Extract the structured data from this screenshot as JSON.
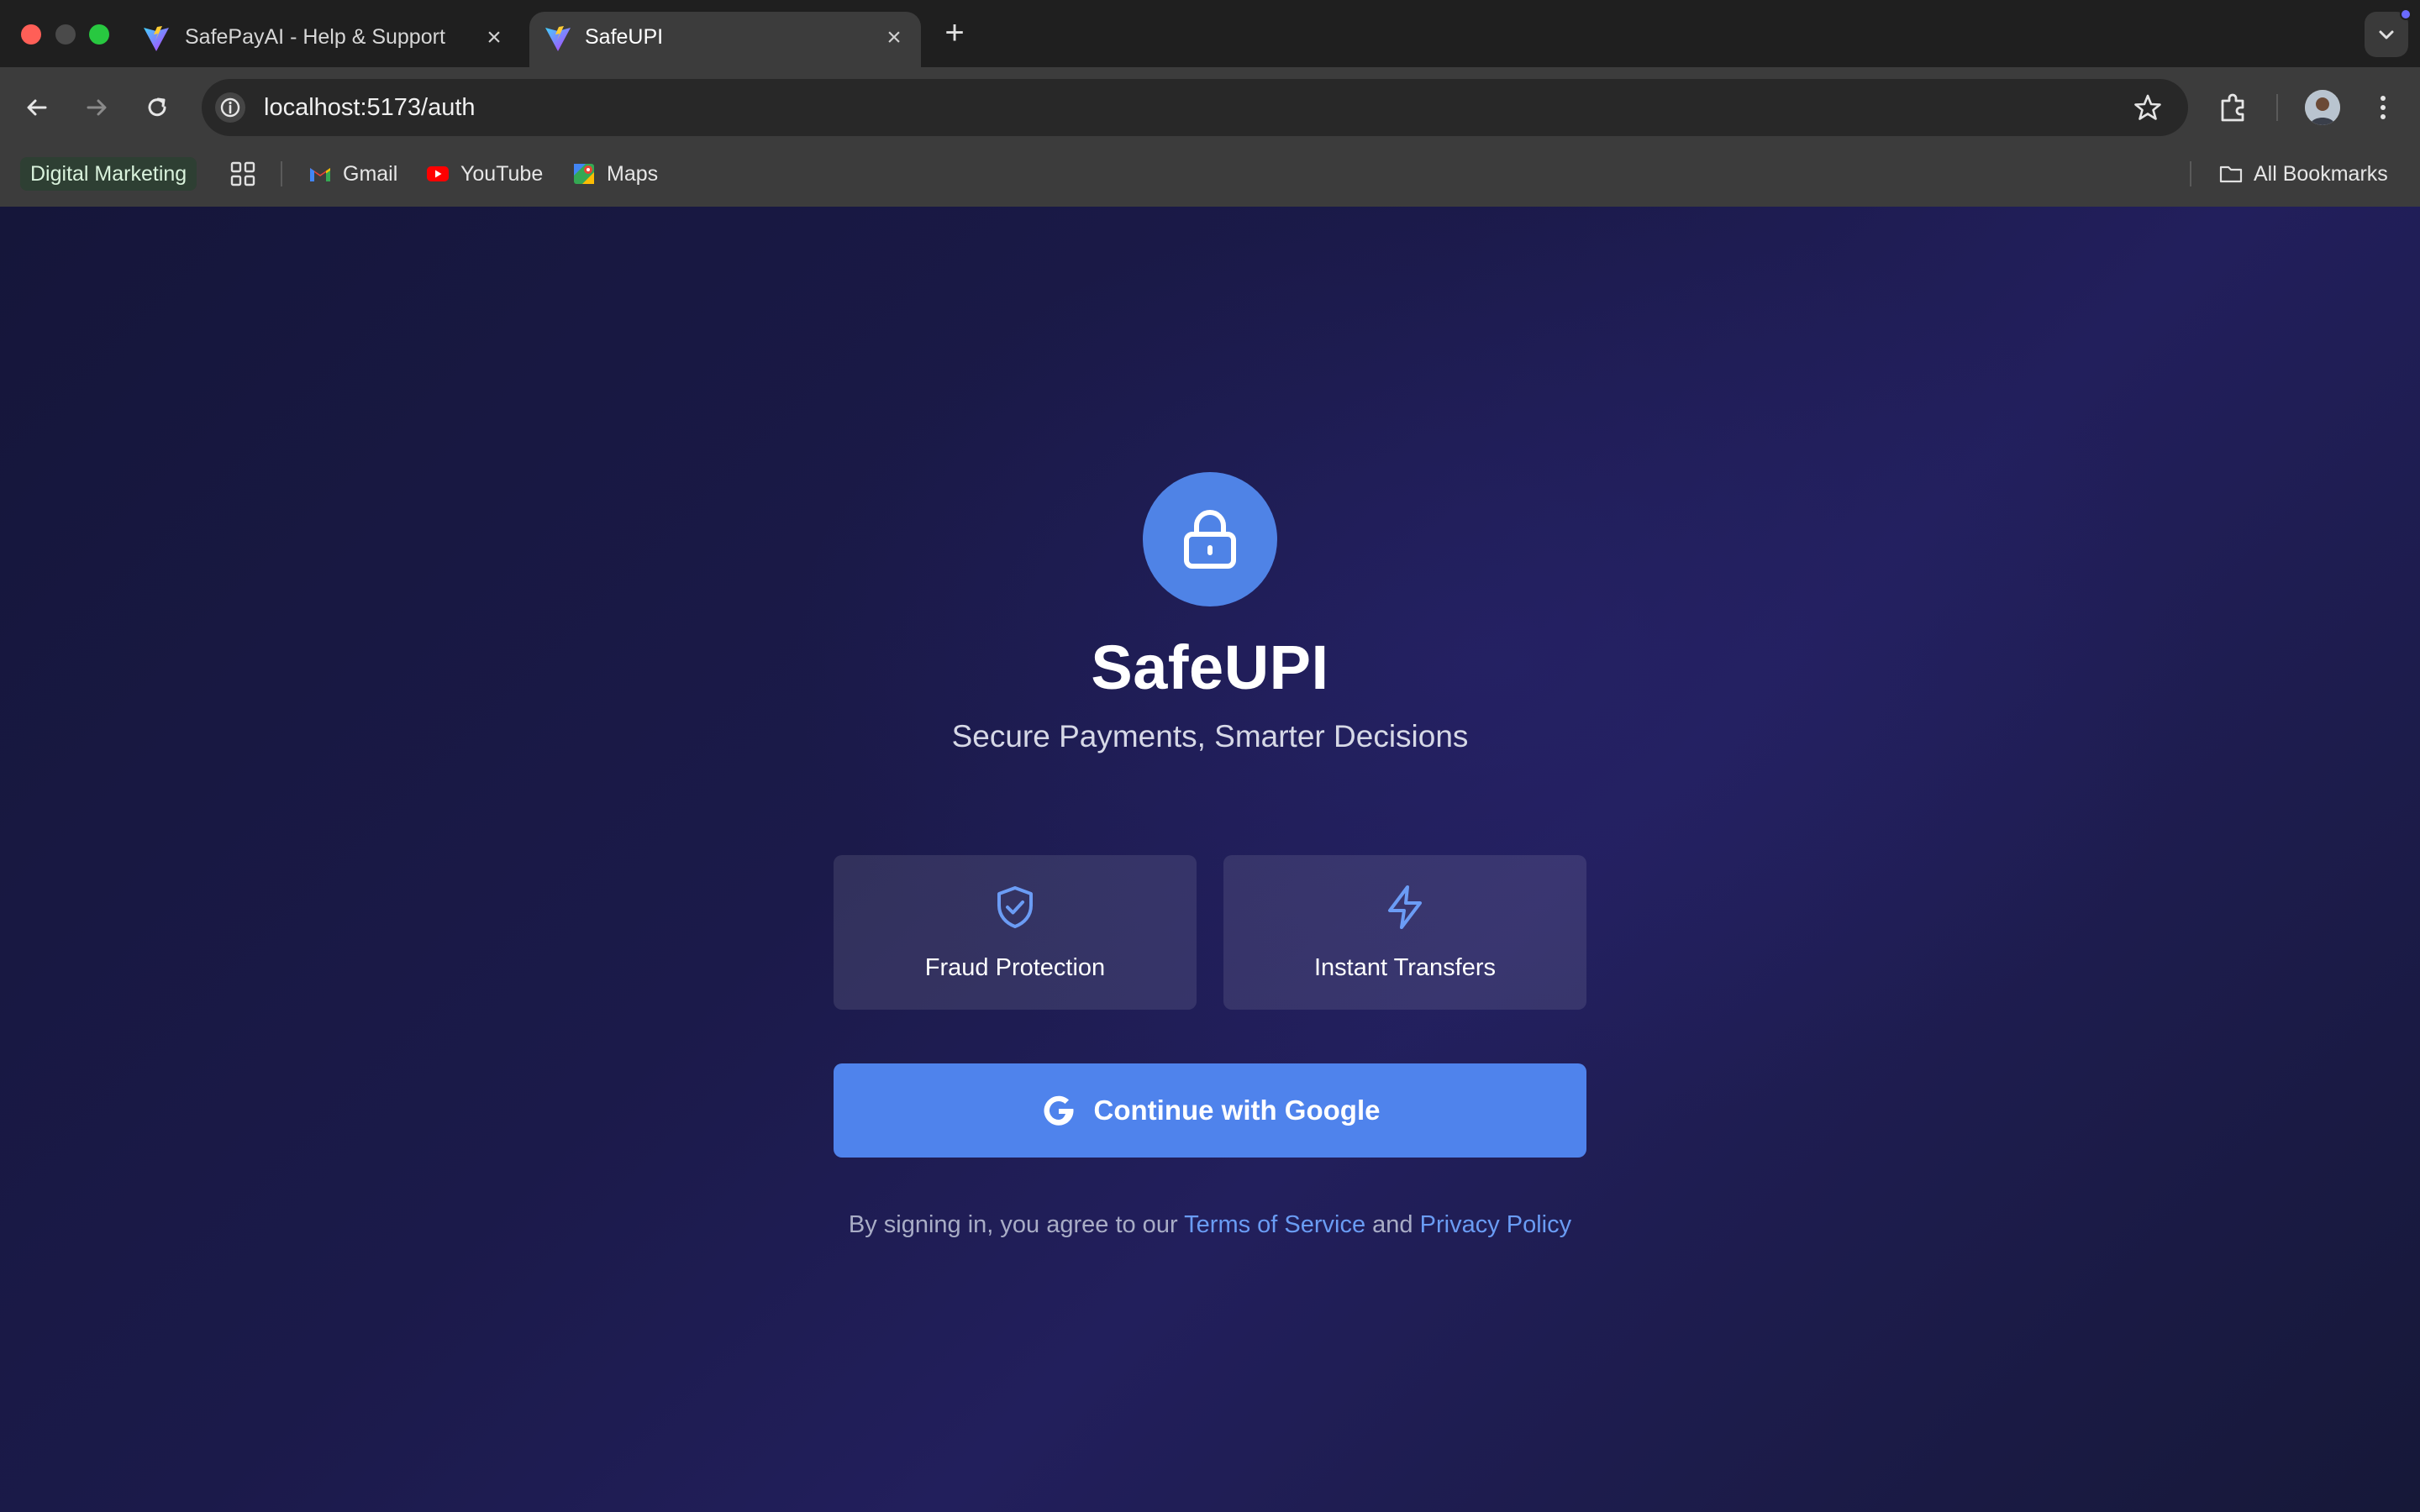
{
  "browser": {
    "tabs": [
      {
        "title": "SafePayAI - Help & Support",
        "active": false
      },
      {
        "title": "SafeUPI",
        "active": true
      }
    ],
    "url": "localhost:5173/auth",
    "bookmarks": {
      "folder_chip": "Digital Marketing",
      "items": [
        {
          "label": "Gmail",
          "icon": "gmail-icon"
        },
        {
          "label": "YouTube",
          "icon": "youtube-icon"
        },
        {
          "label": "Maps",
          "icon": "maps-icon"
        }
      ],
      "all_bookmarks": "All Bookmarks"
    }
  },
  "auth": {
    "logo_icon": "lock-icon",
    "brand": "SafeUPI",
    "tagline": "Secure Payments, Smarter Decisions",
    "features": [
      {
        "label": "Fraud Protection",
        "icon": "shield-check-icon"
      },
      {
        "label": "Instant Transfers",
        "icon": "lightning-icon"
      }
    ],
    "google_button": "Continue with Google",
    "legal": {
      "prefix": "By signing in, you agree to our",
      "terms": "Terms of Service",
      "conjunction": "and",
      "privacy": "Privacy Policy"
    }
  },
  "colors": {
    "accent": "#4f83ec",
    "link": "#6a9cf4",
    "background": "#1b1a4a"
  }
}
